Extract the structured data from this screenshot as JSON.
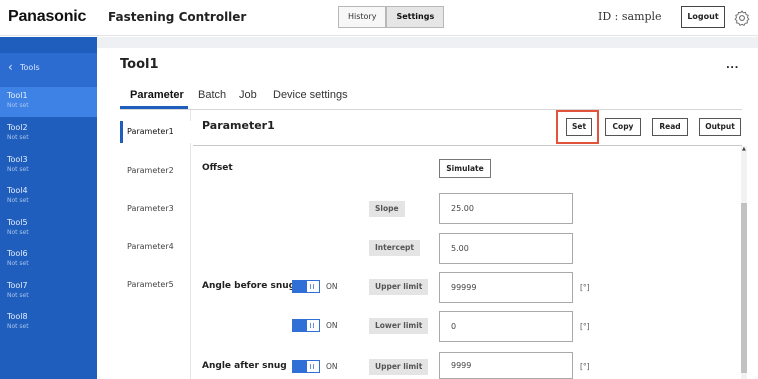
{
  "header": {
    "brand": "Panasonic",
    "app_title": "Fastening Controller",
    "nav": [
      {
        "label": "History",
        "active": false
      },
      {
        "label": "Settings",
        "active": true
      }
    ],
    "user_id": "ID : sample",
    "logout_label": "Logout",
    "settings_icon": "gear-icon"
  },
  "sidebar": {
    "back_label": "Tools",
    "back_icon": "chevron-left-icon",
    "items": [
      {
        "name": "Tool1",
        "status": "Not set",
        "active": true
      },
      {
        "name": "Tool2",
        "status": "Not set",
        "active": false
      },
      {
        "name": "Tool3",
        "status": "Not set",
        "active": false
      },
      {
        "name": "Tool4",
        "status": "Not set",
        "active": false
      },
      {
        "name": "Tool5",
        "status": "Not set",
        "active": false
      },
      {
        "name": "Tool6",
        "status": "Not set",
        "active": false
      },
      {
        "name": "Tool7",
        "status": "Not set",
        "active": false
      },
      {
        "name": "Tool8",
        "status": "Not set",
        "active": false
      }
    ]
  },
  "main": {
    "title": "Tool1",
    "more_label": "...",
    "tabs": [
      {
        "label": "Parameter",
        "active": true
      },
      {
        "label": "Batch",
        "active": false
      },
      {
        "label": "Job",
        "active": false
      },
      {
        "label": "Device settings",
        "active": false
      }
    ],
    "param_list": [
      {
        "label": "Parameter1",
        "active": true
      },
      {
        "label": "Parameter2",
        "active": false
      },
      {
        "label": "Parameter3",
        "active": false
      },
      {
        "label": "Parameter4",
        "active": false
      },
      {
        "label": "Parameter5",
        "active": false
      }
    ],
    "content_title": "Parameter1",
    "actions": {
      "set": "Set",
      "copy": "Copy",
      "read": "Read",
      "output": "Output"
    },
    "highlight_color": "#e2533c",
    "accent_color": "#1f5ebc",
    "form": {
      "offset_label": "Offset",
      "simulate_label": "Simulate",
      "slope_label": "Slope",
      "slope_value": "25.00",
      "intercept_label": "Intercept",
      "intercept_value": "5.00",
      "angle_before_label": "Angle before snug",
      "angle_before_toggle": "ON",
      "upper1_label": "Upper limit",
      "upper1_value": "99999",
      "upper1_unit": "[°]",
      "lower_toggle": "ON",
      "lower_label": "Lower limit",
      "lower_value": "0",
      "lower_unit": "[°]",
      "angle_after_label": "Angle after snug",
      "angle_after_toggle": "ON",
      "upper2_label": "Upper limit",
      "upper2_value": "9999",
      "upper2_unit": "[°]"
    }
  }
}
